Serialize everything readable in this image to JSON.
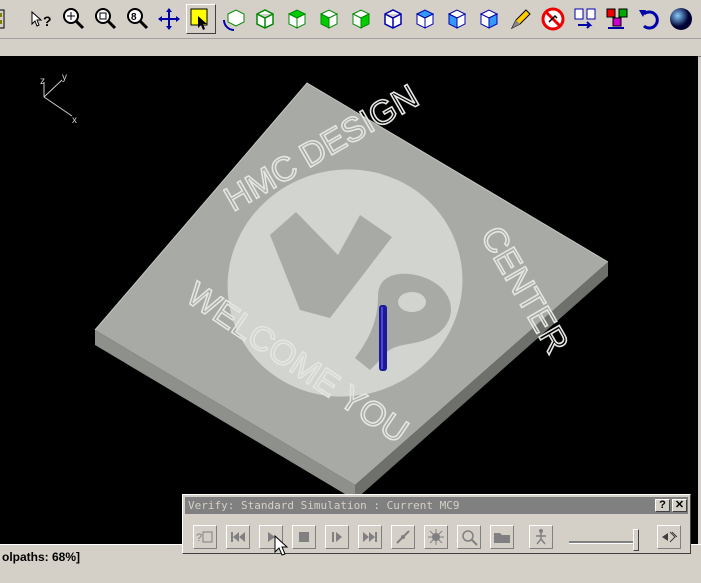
{
  "toolbar": {
    "icons": [
      "sidebar-toggle-icon",
      "zoom-cursor-help-icon",
      "zoom-in-icon",
      "zoom-window-icon",
      "zoom-fit-icon",
      "pan-icon",
      "select-icon",
      "rotate-icon",
      "cube-iso-icon",
      "cube-top-icon",
      "cube-front-icon",
      "cube-side-icon",
      "cube-blue-iso-icon",
      "cube-blue-top-icon",
      "cube-blue-front-icon",
      "cube-blue-side-icon",
      "pencil-icon",
      "no-toolpath-icon",
      "layout-arrange-icon",
      "color-swap-icon",
      "undo-icon",
      "globe-icon"
    ]
  },
  "viewport": {
    "axis_labels": {
      "x": "x",
      "y": "y",
      "z": "z"
    },
    "part": {
      "top_text": "HMC DESIGN",
      "right_text": "CENTER",
      "bottom_text": "WELCOME YOU",
      "logo_text": "V9"
    },
    "colors": {
      "background": "#000000",
      "part_top": "#a8aaa5",
      "tool": "#1a1a9a"
    }
  },
  "status": {
    "text": "olpaths:   68%]"
  },
  "verify": {
    "title": "Verify: Standard Simulation : Current MC9",
    "help_label": "?",
    "close_label": "✕",
    "buttons": [
      "verify-options-icon",
      "rewind-icon",
      "play-icon",
      "stop-icon",
      "step-icon",
      "fast-forward-icon",
      "toolpath-display-icon",
      "stock-display-icon",
      "zoom-verify-icon",
      "save-stl-icon",
      "speed-icon",
      "exit-verify-icon"
    ],
    "speed_fraction": 0.95
  }
}
